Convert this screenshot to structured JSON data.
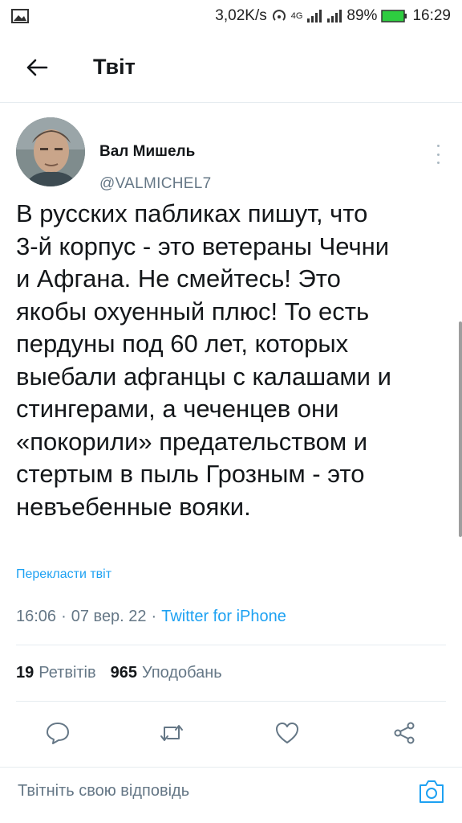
{
  "status_bar": {
    "speed": "3,02K/s",
    "network": "4G",
    "battery": "89%",
    "time": "16:29"
  },
  "header": {
    "title": "Твіт"
  },
  "tweet": {
    "author_name": "Вал Мишель",
    "author_handle": "@VALMICHEL7",
    "text": "В русских пабликах пишут, что\n3-й корпус - это ветераны Чечни\nи Афгана. Не смейтесь! Это\nякобы охуенный плюс! То есть\nпердуны под 60 лет, которых\nвыебали афганцы с калашами и\nстингерами, а чеченцев они\n«покорили» предательством и\nстертым в пыль Грозным - это\nневъебенные вояки.",
    "translate_label": "Перекласти твіт",
    "time": "16:06",
    "date": "07 вер. 22",
    "source": "Twitter for iPhone",
    "retweets_count": "19",
    "retweets_label": "Ретвітів",
    "likes_count": "965",
    "likes_label": "Уподобань"
  },
  "reply": {
    "placeholder": "Твітніть свою відповідь"
  },
  "colors": {
    "accent": "#1da1f2",
    "secondary_text": "#657786",
    "divider": "#e6ecf0"
  },
  "icons": {
    "back": "arrow-left-icon",
    "more": "more-vertical-icon",
    "reply": "reply-icon",
    "retweet": "retweet-icon",
    "like": "heart-icon",
    "share": "share-icon",
    "camera": "camera-icon"
  }
}
